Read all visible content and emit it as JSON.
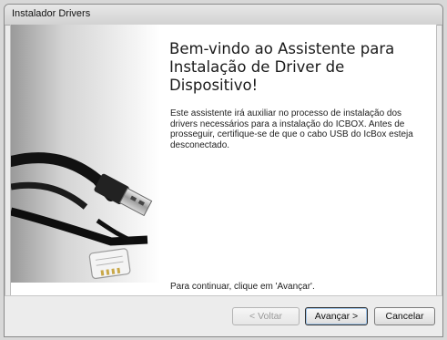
{
  "window": {
    "title": "Instalador Drivers"
  },
  "wizard": {
    "heading_line1": "Bem-vindo ao Assistente para",
    "heading_line2": "Instalação de Driver de Dispositivo!",
    "body": "Este assistente irá auxiliar no processo de instalação dos drivers necessários para a instalação do ICBOX.  Antes de prosseguir, certifique-se de que o cabo USB do IcBox esteja desconectado.",
    "footer": "Para continuar, clique em 'Avançar'."
  },
  "buttons": {
    "back": "< Voltar",
    "next": "Avançar >",
    "cancel": "Cancelar"
  },
  "banner": {
    "image": "usb-and-rj11-cables"
  }
}
